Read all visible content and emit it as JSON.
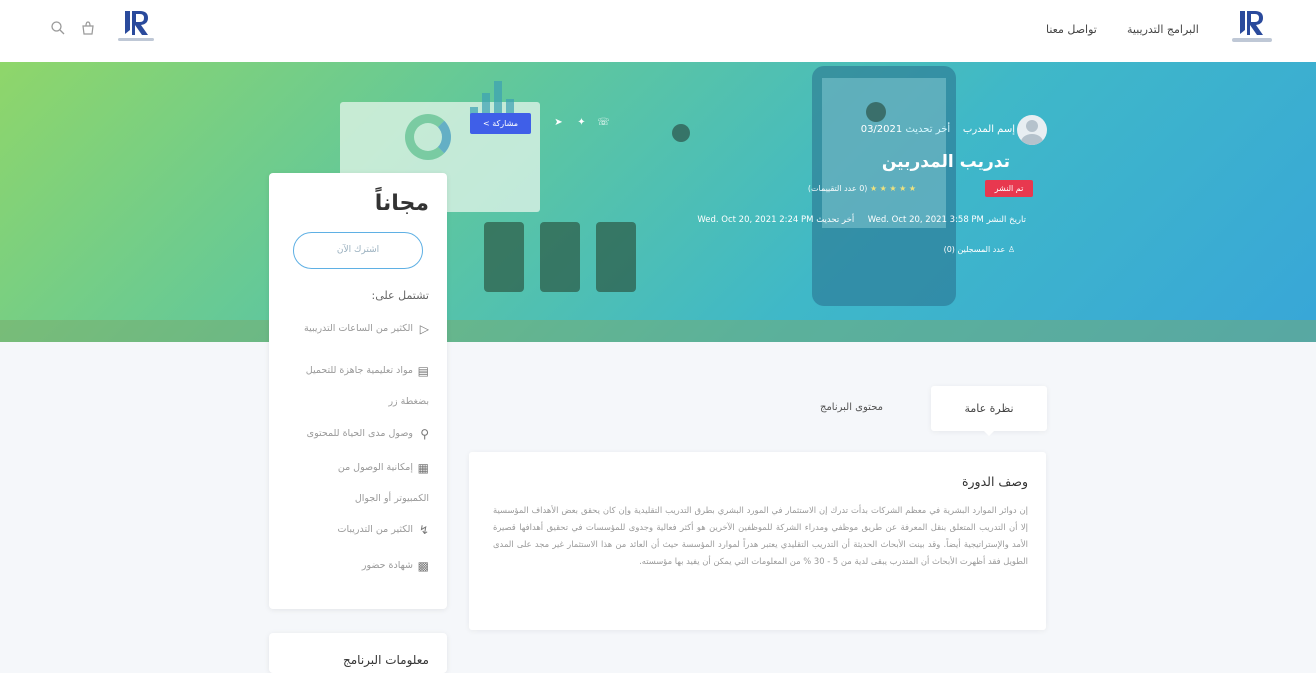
{
  "header": {
    "nav_programs": "البرامج التدريبية",
    "nav_contact": "تواصل معنا",
    "logo_text": "LRJ"
  },
  "hero": {
    "trainer_label": "إسم المدرب",
    "last_update_label": "أخر تحديث",
    "last_update_value": "03/2021",
    "title": "تدريب المدربين",
    "status_badge": "تم النشر",
    "rating_text": "(0 عدد التقييمات)",
    "publish_date_label": "تاريخ النشر",
    "publish_date_value": "Wed. Oct 20, 2021 3:58 PM",
    "updated_label": "أخر تحديث",
    "updated_value": "Wed. Oct 20, 2021 2:24 PM",
    "registered_text": "عدد المسجلين (0)",
    "share_label": "مشاركة"
  },
  "sidebar": {
    "price": "مجاناً",
    "subscribe_button": "اشترك الآن",
    "includes_label": "تشتمل على:",
    "features": [
      "الكثير من الساعات التدريبية",
      "مواد تعليمية جاهزة للتحميل",
      "بضغطة زر",
      "وصول مدى الحياة للمحتوى",
      "إمكانية الوصول من",
      "الكمبيوتر أو الجوال",
      "الكثير من التدريبات",
      "شهادة حضور"
    ],
    "info_title": "معلومات البرنامج"
  },
  "tabs": {
    "overview": "نظرة عامة",
    "content": "محتوى البرنامج"
  },
  "description": {
    "title": "وصف الدورة",
    "body": "إن دوائر الموارد البشرية في معظم الشركات بدأت تدرك إن الاستثمار في المورد البشري بطرق التدريب التقليدية وإن كان يحقق بعض الأهداف المؤسسية إلا أن التدريب المتعلق بنقل المعرفة عن طريق موظفي ومدراء الشركة للموظفين الآخرين هو أكثر فعالية وجدوى للمؤسسات في تحقيق أهدافها قصيرة الأمد والإستراتيجية أيضاً. وقد بينت الأبحاث الحديثة أن التدريب التقليدي يعتبر هدراً لموارد المؤسسة حيث أن العائد من هذا الاستثمار غير مجد على المدى الطويل فقد أظهرت الأبحاث أن المتدرب يبقى لدية من 5 - 30 % من المعلومات التي يمكن أن يفيد بها مؤسسته."
  },
  "colors": {
    "accent_blue": "#3f5fe8",
    "badge_red": "#e8384f",
    "hero_green": "#8fd66a",
    "hero_blue": "#38a6d8"
  }
}
